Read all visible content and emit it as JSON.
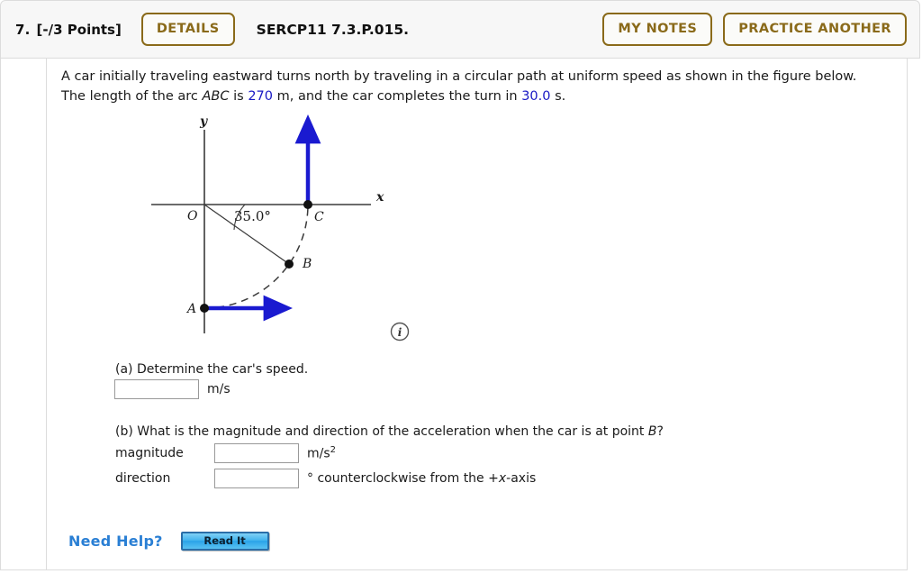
{
  "header": {
    "question_number": "7.",
    "points": "[-/3 Points]",
    "details_label": "DETAILS",
    "question_code": "SERCP11 7.3.P.015.",
    "my_notes_label": "MY NOTES",
    "practice_another_label": "PRACTICE ANOTHER",
    "accent_color": "#8a6a1a"
  },
  "prompt": {
    "line1_before": "A car initially traveling eastward turns north by traveling in a circular path at uniform speed as shown in the figure below.",
    "line2_a": "The length of the arc ",
    "line2_arc": "ABC",
    "line2_b": " is ",
    "arc_length": "270",
    "line2_c": " m, and the car completes the turn in ",
    "turn_time": "30.0",
    "line2_d": " s.",
    "value_color": "#1919c4"
  },
  "figure": {
    "y_axis_label": "y",
    "x_axis_label": "x",
    "origin_label": "O",
    "angle_label": "35.0°",
    "point_a_label": "A",
    "point_b_label": "B",
    "point_c_label": "C",
    "info_icon_label": "i",
    "vector_color": "#1a1ad0",
    "axis_color": "#3a3a3a",
    "arc_color": "#3a3a3a"
  },
  "parts": {
    "a": {
      "prompt_text": "(a) Determine the car's speed.",
      "answer_value": "",
      "unit": "m/s"
    },
    "b": {
      "prompt_before": "(b) What is the magnitude and direction of the acceleration when the car is at point ",
      "prompt_italic": "B",
      "prompt_after": "?",
      "magnitude_label": "magnitude",
      "magnitude_value": "",
      "magnitude_unit_base": "m/s",
      "magnitude_unit_exp": "2",
      "direction_label": "direction",
      "direction_value": "",
      "direction_unit_degree": "°",
      "direction_unit_text_a": " counterclockwise from the +",
      "direction_unit_italic": "x",
      "direction_unit_text_b": "-axis"
    }
  },
  "footer": {
    "need_help_label": "Need Help?",
    "read_it_label": "Read It",
    "need_help_color": "#2a7fd4"
  }
}
